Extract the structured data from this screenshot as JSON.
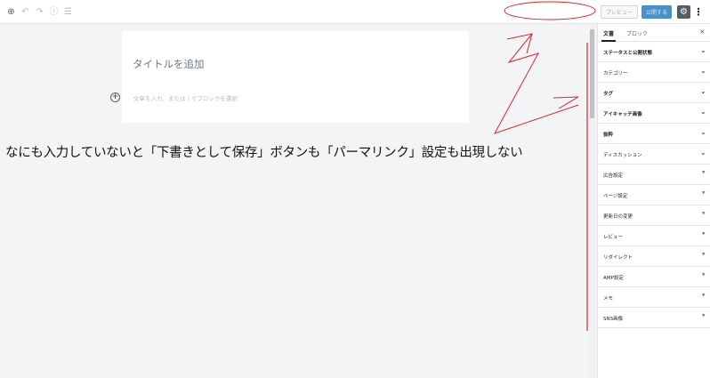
{
  "toolbar": {
    "icons": [
      "add-block-icon",
      "undo-icon",
      "redo-icon",
      "info-icon",
      "list-view-icon"
    ],
    "preview_label": "プレビュー",
    "publish_label": "公開する",
    "settings_icon": "gear-icon",
    "more_icon": "more-vertical-icon"
  },
  "editor": {
    "title_placeholder": "タイトルを追加",
    "body_placeholder": "文章を入力、または / でブロックを選択"
  },
  "annotation": {
    "text": "なにも入力していないと「下書きとして保存」ボタンも「パーマリンク」設定も出現しない",
    "color": "#e02424"
  },
  "sidebar": {
    "tabs": [
      {
        "label": "文書",
        "active": true
      },
      {
        "label": "ブロック",
        "active": false
      }
    ],
    "close_symbol": "×",
    "panels": [
      {
        "label": "ステータスと公開状態",
        "bold": true,
        "indicator": "chevron"
      },
      {
        "label": "カテゴリー",
        "bold": false,
        "indicator": "chevron"
      },
      {
        "label": "タグ",
        "bold": true,
        "indicator": "chevron"
      },
      {
        "label": "アイキャッチ画像",
        "bold": true,
        "indicator": "chevron"
      },
      {
        "label": "抜粋",
        "bold": true,
        "indicator": "chevron"
      },
      {
        "label": "ディスカッション",
        "bold": false,
        "indicator": "chevron"
      },
      {
        "label": "広告設定",
        "bold": false,
        "indicator": "triangle"
      },
      {
        "label": "ページ設定",
        "bold": false,
        "indicator": "triangle"
      },
      {
        "label": "更新日の変更",
        "bold": false,
        "indicator": "triangle"
      },
      {
        "label": "レビュー",
        "bold": false,
        "indicator": "triangle"
      },
      {
        "label": "リダイレクト",
        "bold": false,
        "indicator": "triangle"
      },
      {
        "label": "AMP設定",
        "bold": false,
        "indicator": "triangle"
      },
      {
        "label": "メモ",
        "bold": false,
        "indicator": "triangle"
      },
      {
        "label": "SNS画像",
        "bold": false,
        "indicator": "triangle"
      }
    ]
  }
}
